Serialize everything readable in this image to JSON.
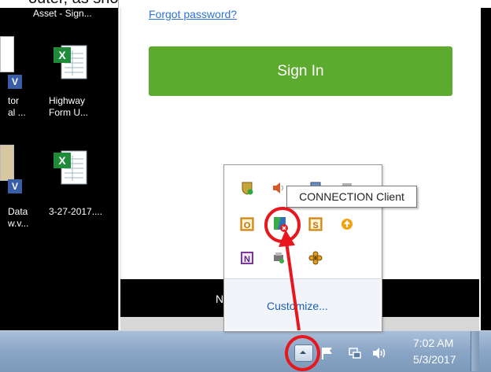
{
  "caption": "outer, as shown below.",
  "desktop": {
    "icons": [
      {
        "label_line1": "Asset - Sign..."
      },
      {
        "label_line1": "tor",
        "label_line2": "al ..."
      },
      {
        "label_line1": "Highway",
        "label_line2": "Form U..."
      },
      {
        "label_line1": "Data",
        "label_line2": "w.v..."
      },
      {
        "label_line1": "3-27-2017...."
      }
    ],
    "badge": "V"
  },
  "browser": {
    "forgot_password": "Forgot password?",
    "sign_in_label": "Sign In",
    "bottom_bar_text": "N",
    "accent_color": "#5cab2e"
  },
  "tray_popup": {
    "tooltip": "CONNECTION Client",
    "customize_label": "Customize...",
    "icons_row1": [
      "shield-icon",
      "speaker-icon",
      "network-icon",
      "app-icon"
    ],
    "icons_row2": [
      "outlook-icon",
      "connection-client-icon",
      "sharepoint-icon",
      "update-icon"
    ],
    "icons_row3": [
      "onenote-icon",
      "printer-icon",
      "flower-icon"
    ],
    "onenote_letter": "N",
    "outlook_letter": "O",
    "sharepoint_letter": "S"
  },
  "taskbar": {
    "time": "7:02 AM",
    "date": "5/3/2017"
  }
}
